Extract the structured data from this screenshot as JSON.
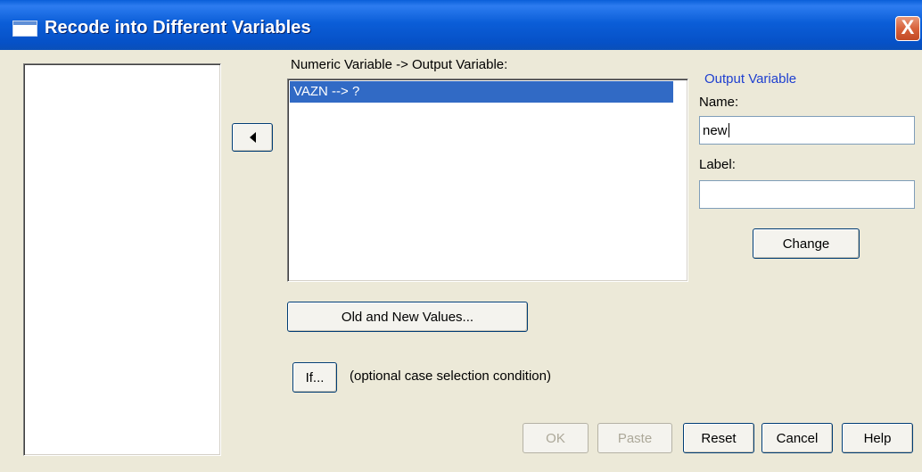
{
  "window": {
    "title": "Recode into Different Variables",
    "close_label": "X"
  },
  "source_list": {
    "items": []
  },
  "move_button": {
    "icon": "arrow-left-icon"
  },
  "numeric_list": {
    "caption": "Numeric Variable -> Output Variable:",
    "items": [
      "VAZN --> ?"
    ]
  },
  "output_group": {
    "caption": "Output Variable",
    "name_label": "Name:",
    "name_value": "new",
    "label_label": "Label:",
    "label_value": "",
    "change_label": "Change"
  },
  "buttons": {
    "old_new": "Old and New Values...",
    "if": "If...",
    "if_note": "(optional case selection condition)",
    "ok": "OK",
    "paste": "Paste",
    "reset": "Reset",
    "cancel": "Cancel",
    "help": "Help"
  },
  "colors": {
    "titlebar": "#0b5ed8",
    "selection": "#316ac5",
    "group_caption": "#1e3fd0",
    "close": "#d8623c"
  }
}
